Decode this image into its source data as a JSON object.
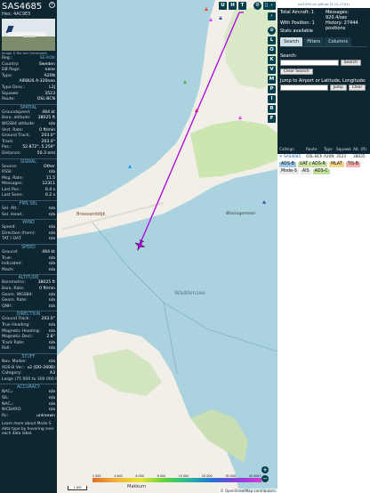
{
  "info": {
    "callsign": "SAS4685",
    "hex": "Hex: 4AC9E5",
    "photo_credit": "Image © Rio Van Ormenstein",
    "rows": [
      {
        "k": "Reg.:",
        "v": "SE-ROK",
        "color": "#6fb3d2"
      },
      {
        "k": "Country:",
        "v": "Sweden"
      },
      {
        "k": "DB flags:",
        "v": "none"
      },
      {
        "k": "Type:",
        "v": "A20N"
      },
      {
        "k": "",
        "v": "AIRBUS A-320neo"
      },
      {
        "k": "Type Desc.:",
        "v": "L2J"
      },
      {
        "k": "Squawk:",
        "v": "3523"
      },
      {
        "k": "Route:",
        "v": "OSL-BCN"
      }
    ],
    "spatial_title": "SPATIAL",
    "spatial": [
      {
        "k": "Groundspeed:",
        "v": "464 kt"
      },
      {
        "k": "Baro. altitude:",
        "v": "38025 ft"
      },
      {
        "k": "WGS84 altitude:",
        "v": "n/a"
      },
      {
        "k": "Vert. Rate:",
        "v": "0 ft/min"
      },
      {
        "k": "Ground Track:",
        "v": "203.0°"
      },
      {
        "k": "Track:",
        "v": "203.0°"
      },
      {
        "k": "Pos.:",
        "v": "52.872°, 5.259°"
      },
      {
        "k": "Distance:",
        "v": "50.3 nmi"
      }
    ],
    "signal_title": "SIGNAL",
    "signal": [
      {
        "k": "Source:",
        "v": "Other"
      },
      {
        "k": "RSSI:",
        "v": "n/a"
      },
      {
        "k": "Msg. Rate:",
        "v": "11.5"
      },
      {
        "k": "Messages:",
        "v": "12311"
      },
      {
        "k": "Last Pos.:",
        "v": "0.4 s"
      },
      {
        "k": "Last Seen:",
        "v": "0.2 s"
      }
    ],
    "fms_title": "FMS SEL",
    "fms": [
      {
        "k": "Sel. Alt.:",
        "v": "n/a"
      },
      {
        "k": "Sel. Head.:",
        "v": "n/a"
      }
    ],
    "wind_title": "WIND",
    "wind": [
      {
        "k": "Speed:",
        "v": "n/a"
      },
      {
        "k": "Direction (from):",
        "v": "n/a"
      },
      {
        "k": "TAT / OAT:",
        "v": "n/a"
      }
    ],
    "speed_title": "SPEED",
    "speed": [
      {
        "k": "Ground:",
        "v": "464 kt"
      },
      {
        "k": "True:",
        "v": "n/a"
      },
      {
        "k": "Indicated:",
        "v": "n/a"
      },
      {
        "k": "Mach:",
        "v": "n/a"
      }
    ],
    "altitude_title": "ALTITUDE",
    "altitude": [
      {
        "k": "Barometric:",
        "v": "38025 ft"
      },
      {
        "k": "Baro. Rate:",
        "v": "0 ft/min"
      },
      {
        "k": "Geom. WGS84:",
        "v": "n/a"
      },
      {
        "k": "Geom. Rate:",
        "v": "n/a"
      },
      {
        "k": "QNH:",
        "v": "n/a"
      }
    ],
    "direction_title": "DIRECTION",
    "direction": [
      {
        "k": "Ground Track:",
        "v": "203.0°"
      },
      {
        "k": "True Heading:",
        "v": "n/a"
      },
      {
        "k": "Magnetic Heading:",
        "v": "n/a"
      },
      {
        "k": "Magnetic Decl.:",
        "v": "2.8°"
      },
      {
        "k": "Track Rate:",
        "v": "n/a"
      },
      {
        "k": "Roll:",
        "v": "n/a"
      }
    ],
    "stuff_title": "STUFF",
    "stuff": [
      {
        "k": "Nav. Modes:",
        "v": "n/a"
      },
      {
        "k": "ADS-B Ver.:",
        "v": "v2 (DO-260B)"
      },
      {
        "k": "Category:",
        "v": "A3"
      },
      {
        "k": "Large (75 000 to 300 000 lb)",
        "v": ""
      }
    ],
    "accuracy_title": "ACCURACY",
    "accuracy": [
      {
        "k": "NACₚ:",
        "v": "n/a"
      },
      {
        "k": "SIL:",
        "v": "n/a"
      },
      {
        "k": "NACᵥ:",
        "v": "n/a"
      },
      {
        "k": "NICBARO:",
        "v": "n/a"
      },
      {
        "k": "Rc:",
        "v": "unknown"
      }
    ],
    "footer": "Learn more about Mode S data type by hovering over each data label."
  },
  "map": {
    "buttons_top": [
      "U",
      "H",
      "T"
    ],
    "buttons_side": [
      "L",
      "O",
      "K",
      "V",
      "M",
      "P",
      "I",
      "R",
      "F"
    ],
    "place_labels": [
      "Breezanddijk",
      "Waddenzee",
      "Makkum",
      "Wieringermeer"
    ],
    "zoom_in": "+",
    "zoom_out": "−",
    "scale": "1 NM",
    "alt_labels": [
      "2 000",
      "4 000",
      "6 000",
      "8 000",
      "10 000",
      "20 000",
      "30 000",
      "40 000+"
    ],
    "attribution": "© OpenStreetMap contributors."
  },
  "right": {
    "link": "tar1090 on github (3.11.1741)",
    "total_label": "Total Aircraft: 1",
    "pos_label": "With Position: 1",
    "stats_label": "Stats available",
    "msgs_label": "Messages:",
    "msgs_value": "920.4/sec",
    "history_label": "History: 27444",
    "history_value": "positions",
    "tabs": [
      "Search",
      "Filters",
      "Columns"
    ],
    "search_label": "Search:",
    "search_button": "Search",
    "clear_search": "Clear Search",
    "jump_label": "Jump to Airport or Latitude, Longitude:",
    "jump_button": "Jump",
    "clear_button": "Clear",
    "columns": [
      "Callsign",
      "Route",
      "Type",
      "Squawk",
      "Alt. (ft)"
    ],
    "row": {
      "callsign": "SAS4685",
      "route": "OSL-BCN",
      "type": "A20N",
      "squawk": "3523",
      "alt": "38025"
    },
    "legend": [
      {
        "label": "ADS-B",
        "color": "#9cc8e8"
      },
      {
        "label": "UAT / ADS-R",
        "color": "#c8e0a0"
      },
      {
        "label": "MLAT",
        "color": "#f5d58a"
      },
      {
        "label": "TIS-B",
        "color": "#f2b0b0"
      },
      {
        "label": "Mode-S",
        "color": "#e8e8e8"
      },
      {
        "label": "AIS",
        "color": "#e8e8e8"
      },
      {
        "label": "ADS-C",
        "color": "#c0e0a0"
      }
    ]
  }
}
